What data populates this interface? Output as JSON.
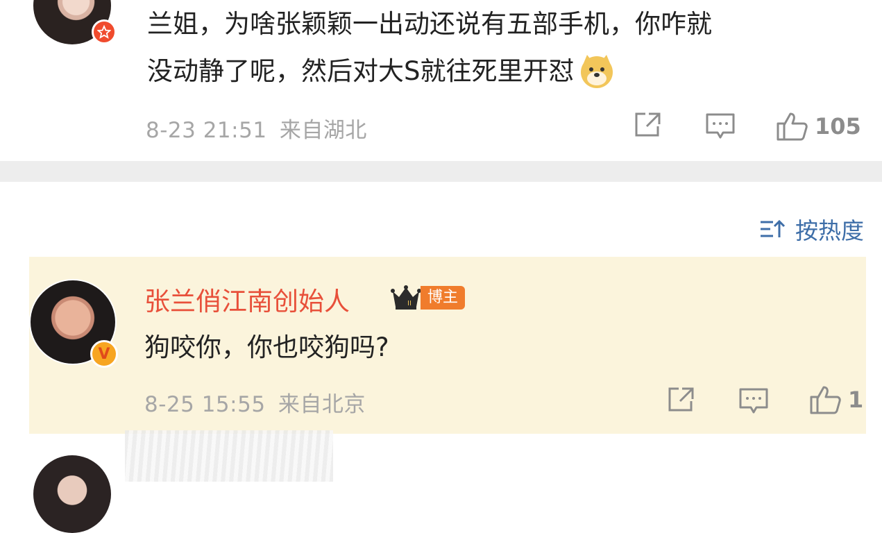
{
  "comment1": {
    "text_line1": "兰姐，为啥张颖颖一出动还说有五部手机，你咋就",
    "text_line2": "没动静了呢，然后对大S就往死里开怼",
    "emoji": "doge-emoji",
    "date": "8-23 21:51",
    "location": "来自湖北",
    "like_count": "105"
  },
  "sort": {
    "icon": "sort-icon",
    "label": "按热度"
  },
  "reply": {
    "username": "张兰俏江南创始人",
    "badge_label": "博主",
    "crown_level": "II",
    "text": "狗咬你，你也咬狗吗?",
    "date": "8-25 15:55",
    "location": "来自北京",
    "like_count": "1"
  },
  "colors": {
    "username": "#e8503a",
    "link_blue": "#3e6ea8",
    "highlight_bg": "#fbf4dc",
    "meta_gray": "#a6a6a6",
    "badge_orange": "#f07c2c"
  }
}
